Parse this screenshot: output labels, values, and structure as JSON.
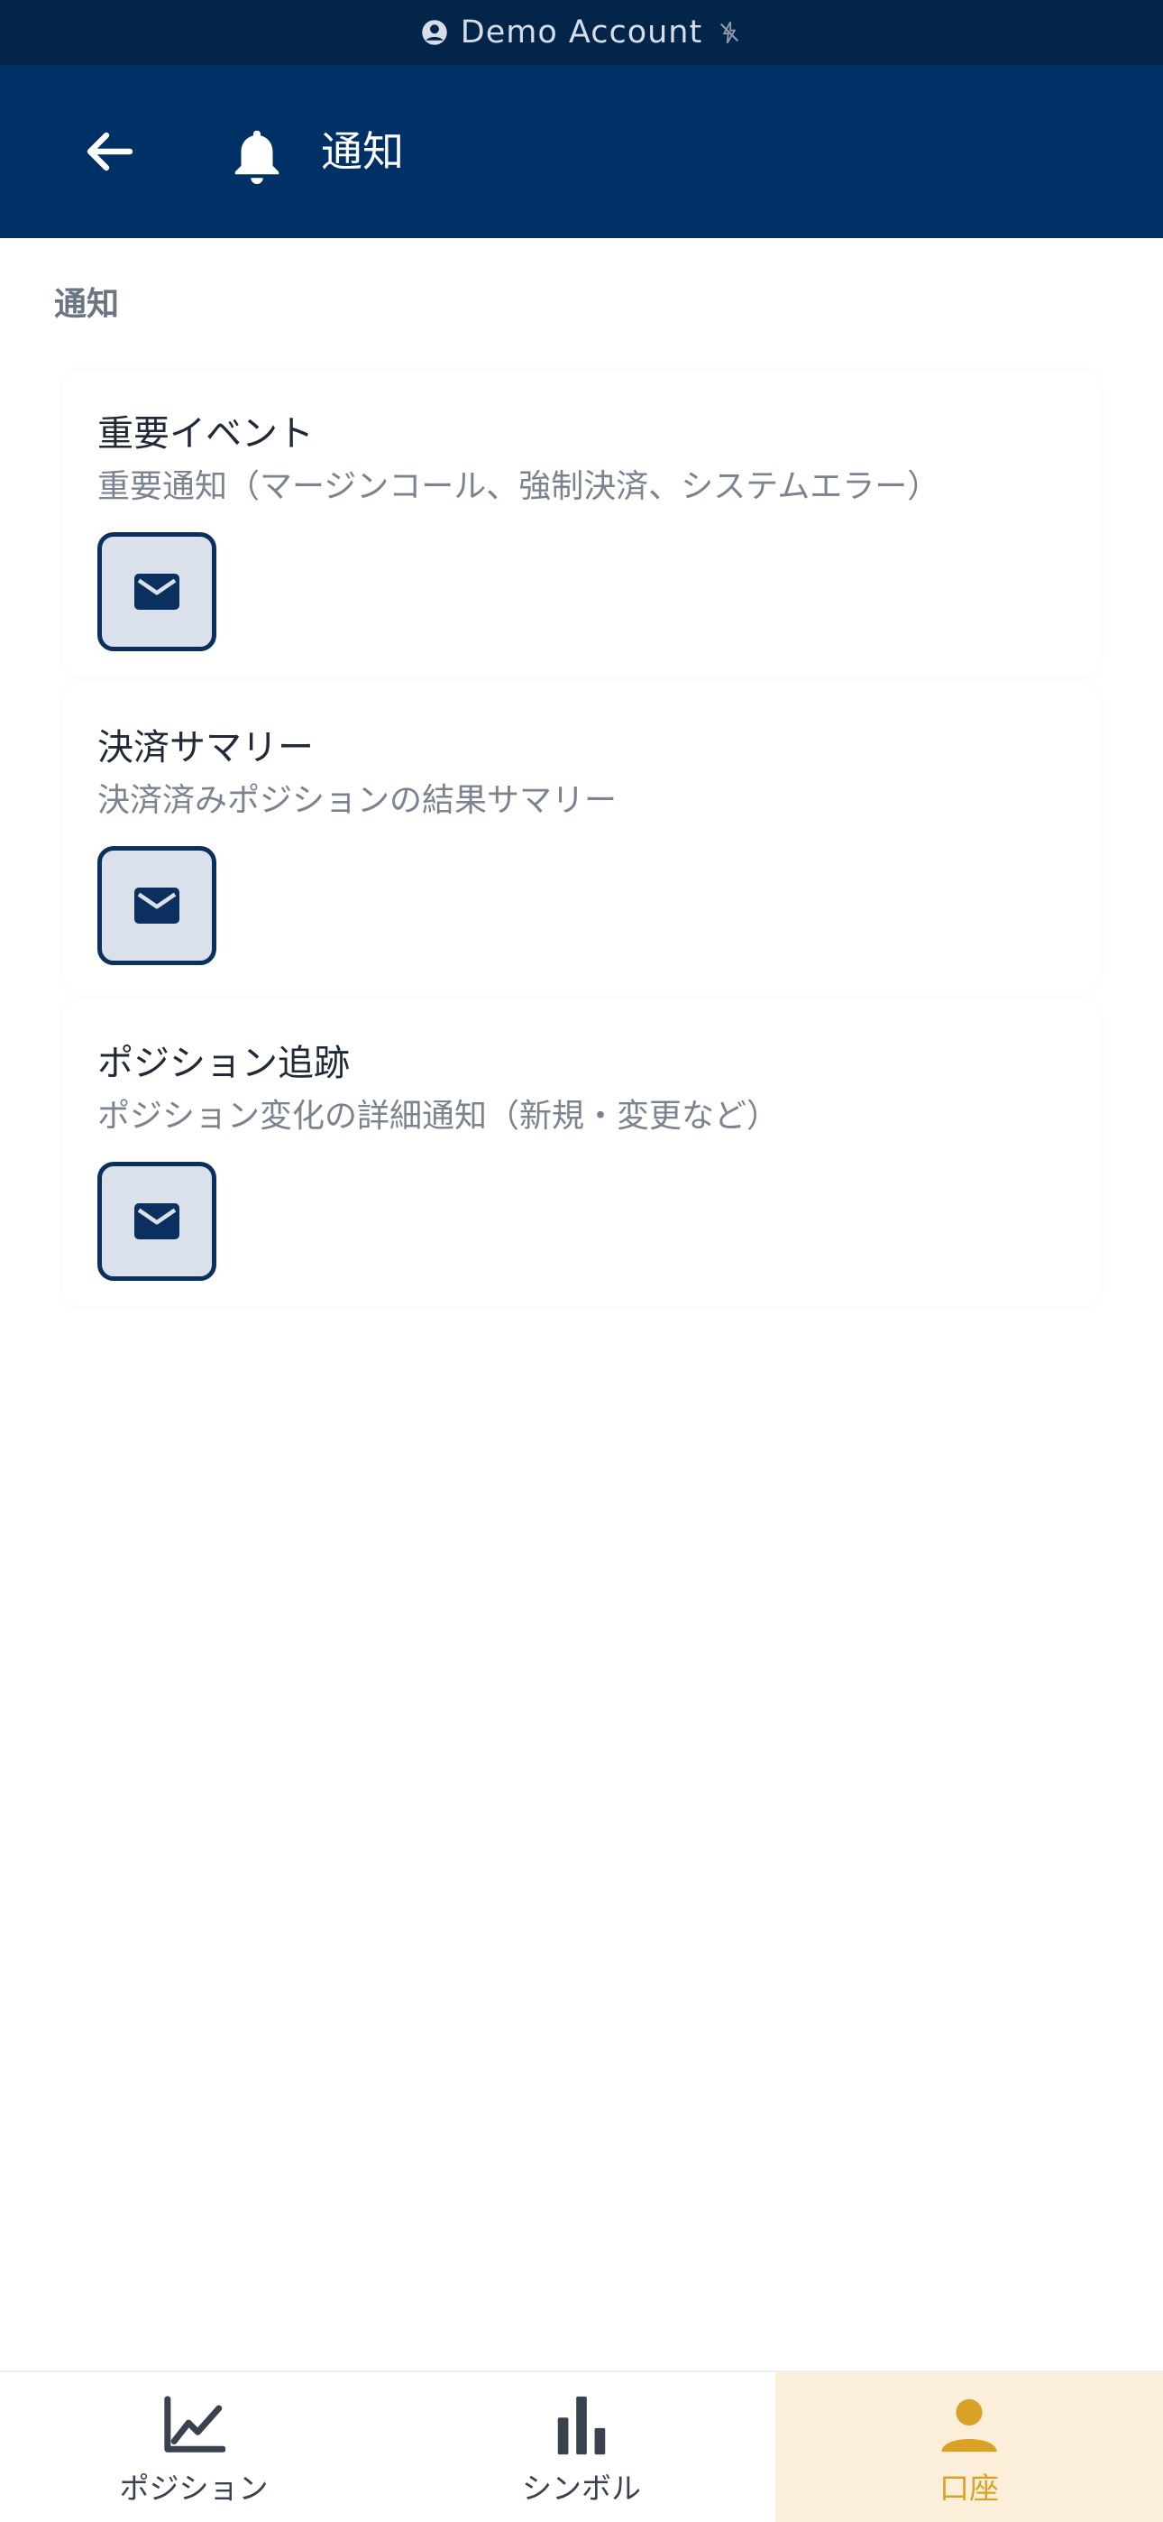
{
  "account_banner": {
    "label": "Demo Account",
    "person_icon": "account-circle-icon",
    "status_icon": "offline-bolt-icon"
  },
  "app_bar": {
    "back_icon": "arrow-left-icon",
    "title_icon": "bell-icon",
    "title": "通知"
  },
  "section": {
    "label": "通知"
  },
  "cards": [
    {
      "title": "重要イベント",
      "description": "重要通知（マージンコール、強制決済、システムエラー）",
      "channel_icon": "mail-icon"
    },
    {
      "title": "決済サマリー",
      "description": "決済済みポジションの結果サマリー",
      "channel_icon": "mail-icon"
    },
    {
      "title": "ポジション追跡",
      "description": "ポジション変化の詳細通知（新規・変更など）",
      "channel_icon": "mail-icon"
    }
  ],
  "bottom_nav": {
    "items": [
      {
        "label": "ポジション",
        "icon": "line-chart-icon",
        "active": false
      },
      {
        "label": "シンボル",
        "icon": "bar-chart-icon",
        "active": false
      },
      {
        "label": "口座",
        "icon": "person-icon",
        "active": true
      }
    ]
  },
  "colors": {
    "banner_bg": "#04254a",
    "app_bar_bg": "#003166",
    "toggle_border": "#0b2f5e",
    "toggle_bg": "#dae1ea",
    "active_nav_bg": "#fbefd9",
    "active_nav_fg": "#d9a126"
  }
}
